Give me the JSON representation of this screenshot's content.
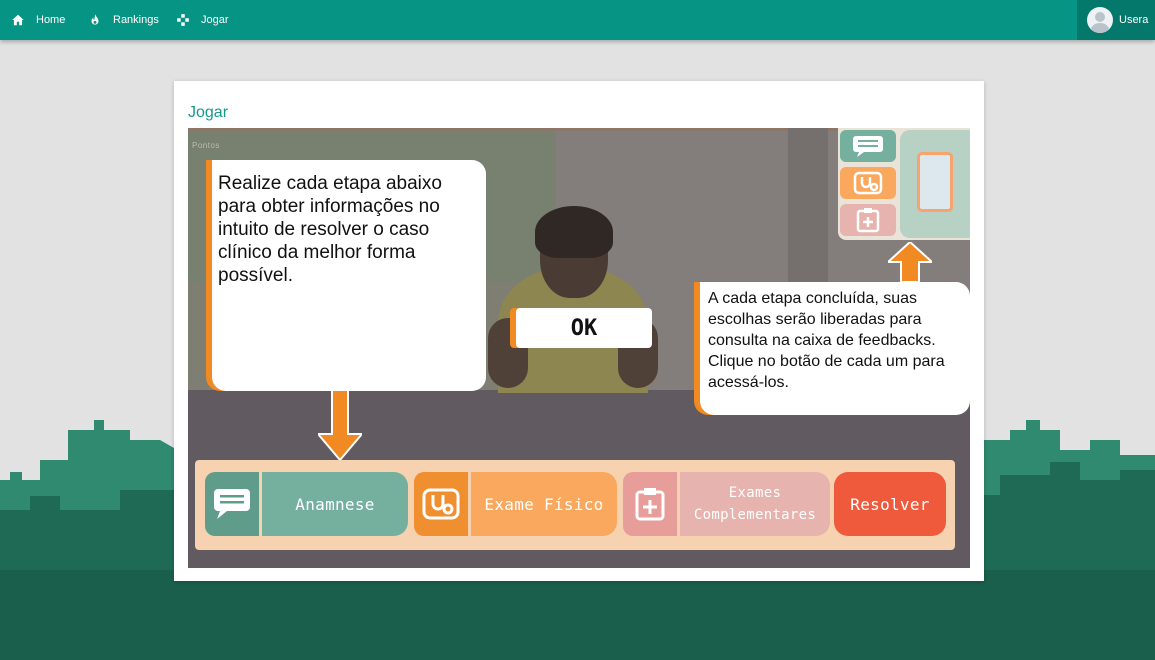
{
  "navbar": {
    "home_label": "Home",
    "rankings_label": "Rankings",
    "jogar_label": "Jogar",
    "user_name": "Usera"
  },
  "card": {
    "title": "Jogar"
  },
  "game": {
    "pontos_label": "Pontos",
    "intro_text": "Realize cada etapa abaixo para obter informações no intuito de resolver o caso clínico da melhor forma possível.",
    "feedback_text": "A cada etapa concluída, suas escolhas serão liberadas para consulta na caixa de feedbacks. Clique no botão de cada um para acessá-los.",
    "ok_label": "OK",
    "steps": {
      "anamnese": "Anamnese",
      "exame_fisico": "Exame Físico",
      "exames_complementares_1": "Exames",
      "exames_complementares_2": "Complementares",
      "resolver": "Resolver"
    }
  },
  "colors": {
    "navbar": "#069484",
    "accent_orange": "#f18a23",
    "anamnese": "#75b09e",
    "exame_fisico": "#f9a85e",
    "exames_complementares": "#e7b3ae",
    "resolver": "#f05a3c"
  },
  "icons": {
    "home": "home-icon",
    "rankings": "flame-icon",
    "jogar": "gamepad-icon",
    "anamnese": "chat-icon",
    "exame_fisico": "stethoscope-icon",
    "exames_complementares": "clipboard-plus-icon"
  }
}
